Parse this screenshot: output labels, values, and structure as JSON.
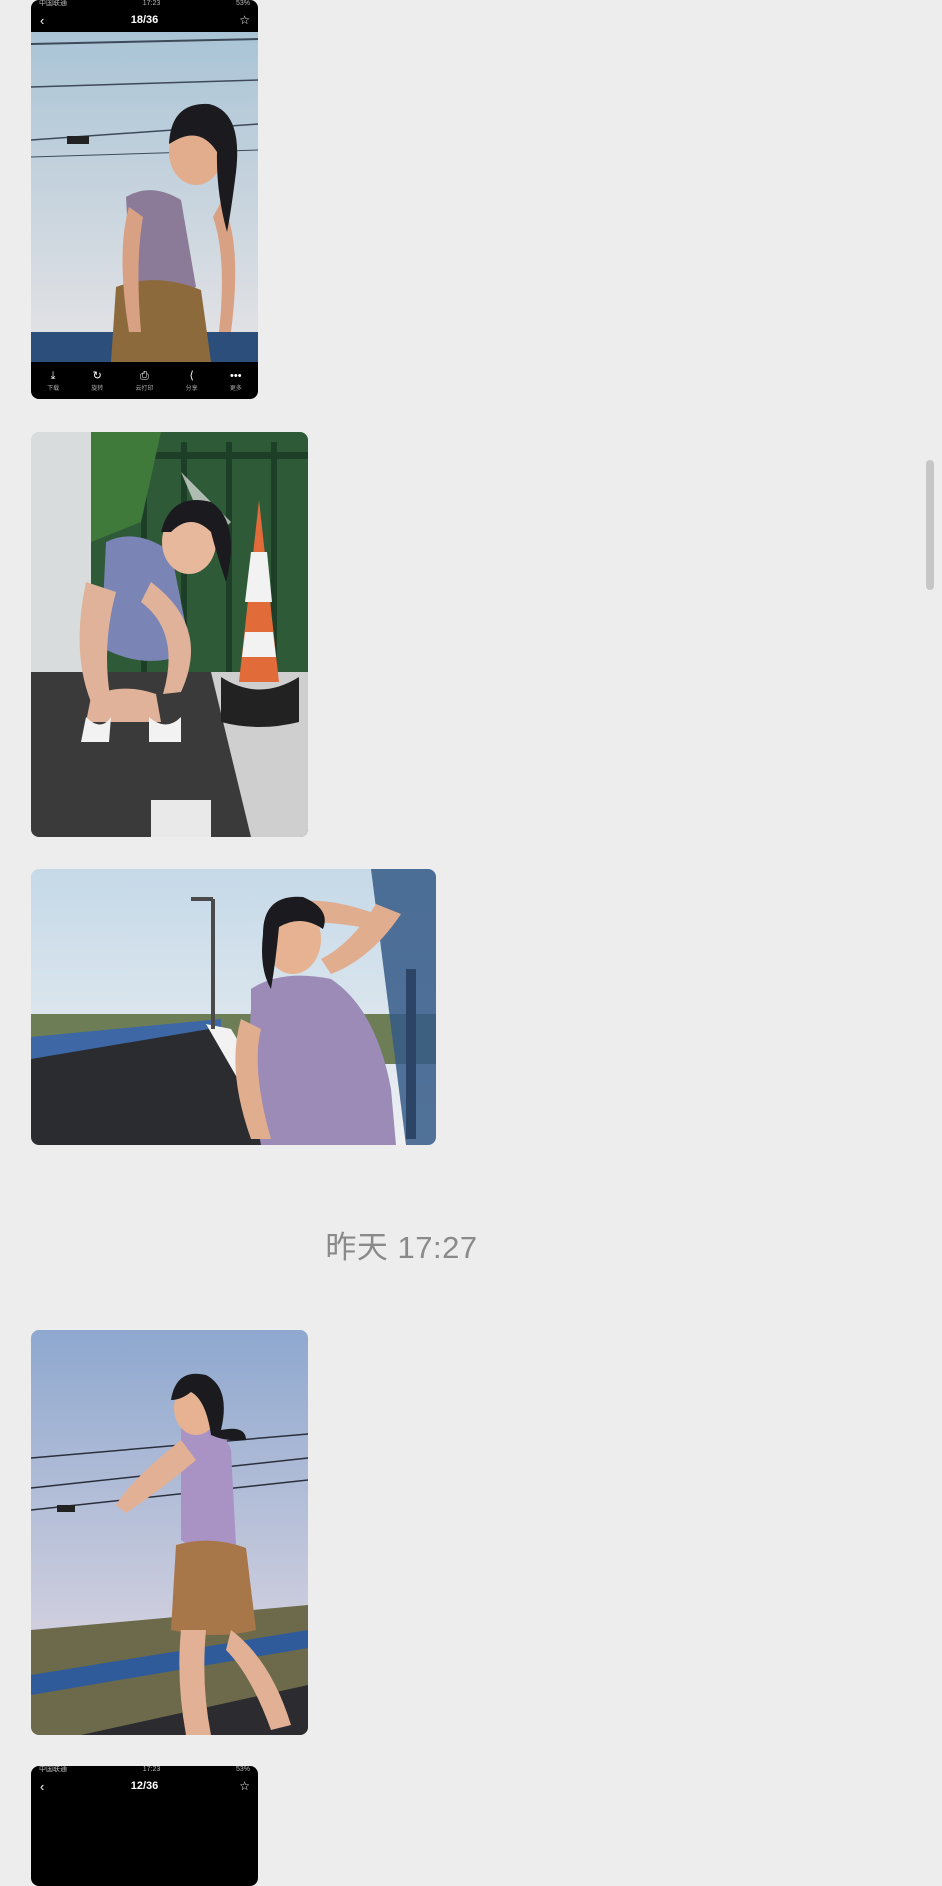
{
  "chat": {
    "timestamp": "昨天 17:27"
  },
  "screenshot_top": {
    "status_left": "中国联通 ",
    "status_time": "17:23",
    "status_right": "53%",
    "counter": "18/36",
    "back_icon": "chevron-left-icon",
    "favorite_icon": "star-icon",
    "toolbar": [
      {
        "icon": "download-icon",
        "glyph": "⤓",
        "label": "下载"
      },
      {
        "icon": "rotate-icon",
        "glyph": "↻",
        "label": "旋转"
      },
      {
        "icon": "print-icon",
        "glyph": "⎙",
        "label": "云打印"
      },
      {
        "icon": "share-icon",
        "glyph": "⟨",
        "label": "分享"
      },
      {
        "icon": "more-icon",
        "glyph": "•••",
        "label": "更多"
      }
    ]
  },
  "screenshot_bottom": {
    "status_left": "中国联通 ",
    "status_time": "17:23",
    "status_right": "53%",
    "counter": "12/36",
    "back_icon": "chevron-left-icon",
    "favorite_icon": "star-icon"
  },
  "colors": {
    "background": "#ededed",
    "timestamp": "#8a8a8a",
    "scrollbar": "#c6c6c6"
  }
}
